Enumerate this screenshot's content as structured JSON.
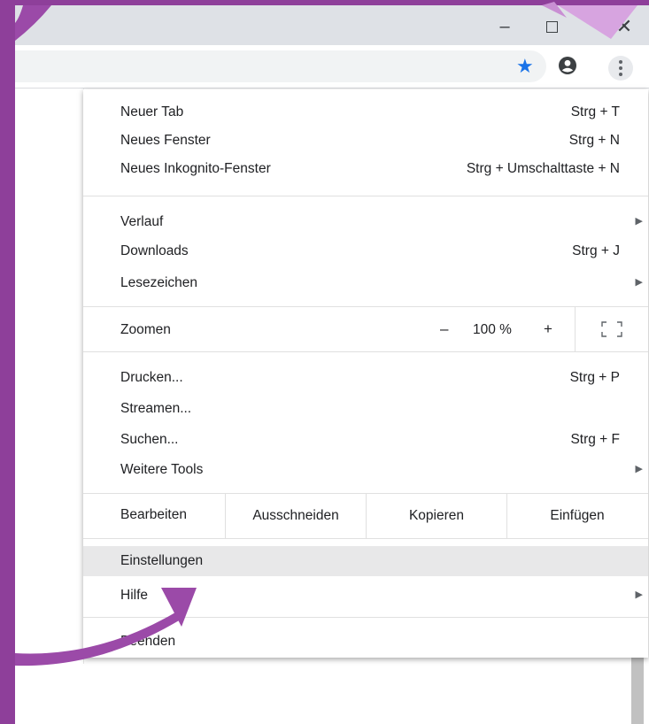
{
  "window": {
    "min_glyph": "–",
    "close_glyph": "✕"
  },
  "menu": {
    "group1": [
      {
        "label": "Neuer Tab",
        "shortcut": "Strg + T"
      },
      {
        "label": "Neues Fenster",
        "shortcut": "Strg + N"
      },
      {
        "label": "Neues Inkognito-Fenster",
        "shortcut": "Strg + Umschalttaste + N"
      }
    ],
    "group2": [
      {
        "label": "Verlauf",
        "shortcut": ""
      },
      {
        "label": "Downloads",
        "shortcut": "Strg + J"
      },
      {
        "label": "Lesezeichen",
        "shortcut": ""
      }
    ],
    "zoom": {
      "label": "Zoomen",
      "minus": "–",
      "value": "100 %",
      "plus": "+"
    },
    "group4": [
      {
        "label": "Drucken...",
        "shortcut": "Strg + P"
      },
      {
        "label": "Streamen...",
        "shortcut": ""
      },
      {
        "label": "Suchen...",
        "shortcut": "Strg + F"
      },
      {
        "label": "Weitere Tools",
        "shortcut": ""
      }
    ],
    "edit": {
      "label": "Bearbeiten",
      "cut": "Ausschneiden",
      "copy": "Kopieren",
      "paste": "Einfügen"
    },
    "group6": [
      {
        "label": "Einstellungen"
      },
      {
        "label": "Hilfe"
      }
    ],
    "exit": {
      "label": "Beenden"
    },
    "submenu_arrow": "▶"
  },
  "colors": {
    "frame": "#8e3f9a",
    "annotation_arrow": "#9b4aa8",
    "star": "#1a73e8"
  },
  "icons": [
    "minimize-icon",
    "maximize-icon",
    "close-icon",
    "star-icon",
    "profile-icon",
    "more-menu-icon",
    "fullscreen-icon"
  ]
}
